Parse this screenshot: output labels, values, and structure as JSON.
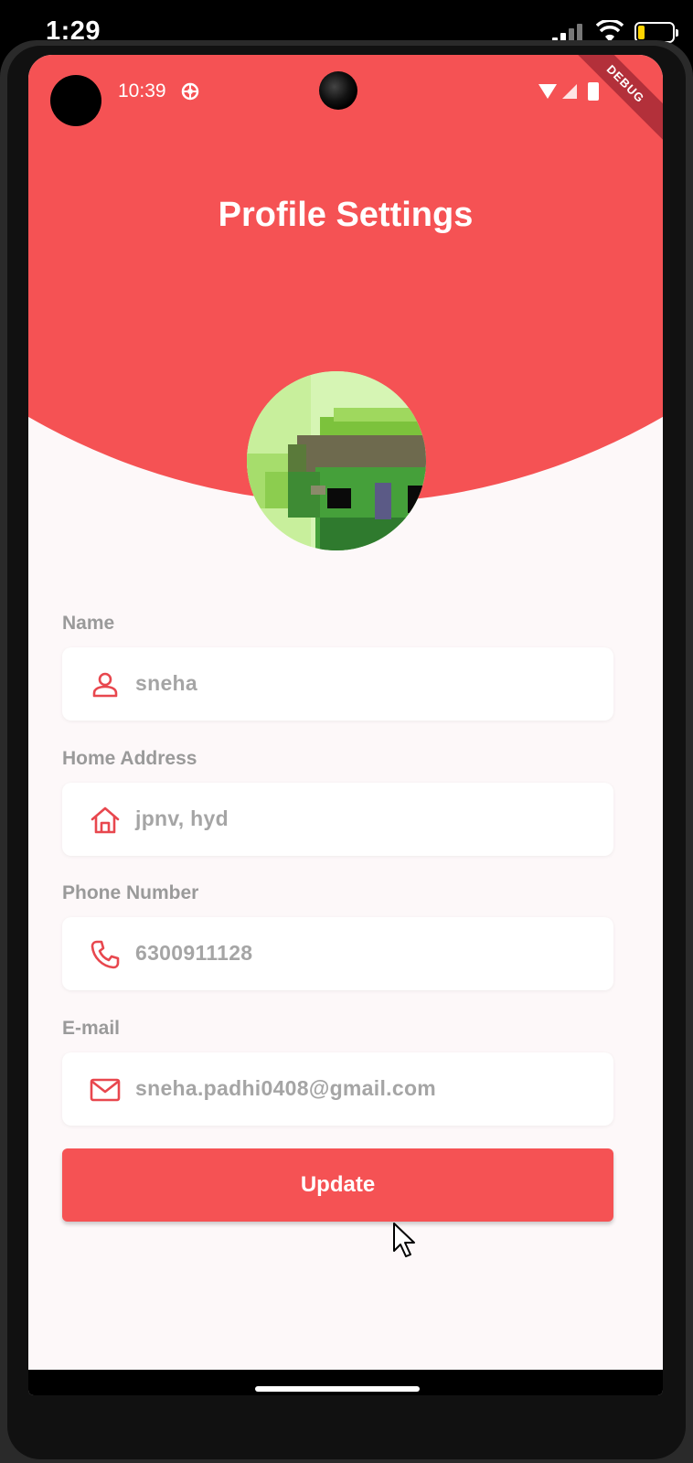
{
  "ios_status": {
    "time": "1:29"
  },
  "android_status": {
    "time": "10:39"
  },
  "debug_banner": "DEBUG",
  "page": {
    "title": "Profile Settings"
  },
  "fields": [
    {
      "label": "Name",
      "value": "sneha",
      "icon": "person-icon"
    },
    {
      "label": "Home Address",
      "value": "jpnv, hyd",
      "icon": "home-icon"
    },
    {
      "label": "Phone Number",
      "value": "6300911128",
      "icon": "phone-icon"
    },
    {
      "label": "E-mail",
      "value": "sneha.padhi0408@gmail.com",
      "icon": "mail-icon"
    }
  ],
  "actions": {
    "update_label": "Update"
  },
  "colors": {
    "accent": "#f55254",
    "background": "#fdf8f9",
    "label": "#9a9a9a",
    "value": "#a5a5a5"
  }
}
